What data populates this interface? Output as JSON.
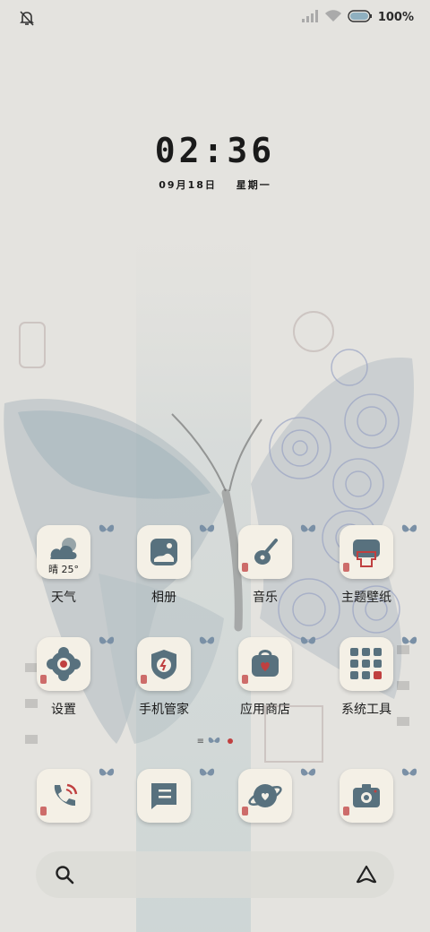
{
  "status_bar": {
    "battery_text": "100%",
    "icons": [
      "silent-bell-icon",
      "signal-icon",
      "wifi-icon",
      "battery-icon"
    ]
  },
  "lock": {
    "time": "02:36",
    "date": "09月18日",
    "weekday": "星期一"
  },
  "apps": [
    {
      "label": "天气",
      "icon": "weather-icon",
      "temp": "晴 25°"
    },
    {
      "label": "相册",
      "icon": "gallery-icon"
    },
    {
      "label": "音乐",
      "icon": "music-icon"
    },
    {
      "label": "主题壁纸",
      "icon": "themes-icon"
    },
    {
      "label": "设置",
      "icon": "settings-icon"
    },
    {
      "label": "手机管家",
      "icon": "phone-manager-icon"
    },
    {
      "label": "应用商店",
      "icon": "app-store-icon"
    },
    {
      "label": "系统工具",
      "icon": "system-tools-folder-icon"
    }
  ],
  "dock": [
    {
      "icon": "phone-icon"
    },
    {
      "icon": "messages-icon"
    },
    {
      "icon": "browser-icon"
    },
    {
      "icon": "camera-icon"
    }
  ],
  "page_indicator": {
    "icon": "butterfly-icon"
  },
  "search_bar": {
    "icons": [
      "search-icon",
      "assistant-icon"
    ]
  },
  "colors": {
    "accent": "#58717e",
    "seal": "#c04040",
    "tile": "#f4f0e6"
  }
}
